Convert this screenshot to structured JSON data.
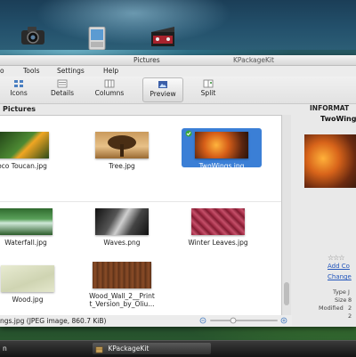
{
  "window": {
    "title": "Pictures",
    "app": "KPackageKit"
  },
  "menu": [
    "o",
    "Tools",
    "Settings",
    "Help"
  ],
  "toolbar": [
    {
      "label": "Icons",
      "icon": "icons-view-icon"
    },
    {
      "label": "Details",
      "icon": "details-view-icon"
    },
    {
      "label": "Columns",
      "icon": "columns-view-icon"
    },
    {
      "label": "Preview",
      "icon": "preview-icon",
      "active": true
    },
    {
      "label": "Split",
      "icon": "split-icon"
    }
  ],
  "location": "Pictures",
  "files": [
    {
      "name": "oco Toucan.jpg",
      "color": "#3b6d2c"
    },
    {
      "name": "Tree.jpg",
      "color": "#b07a3a"
    },
    {
      "name": "TwoWings.jpg",
      "color": "#e06a1a",
      "selected": true
    },
    {
      "name": "Waterfall.jpg",
      "color": "#3f7d45"
    },
    {
      "name": "Waves.png",
      "color": "#444444"
    },
    {
      "name": "Winter Leaves.jpg",
      "color": "#a8324a"
    },
    {
      "name": "Wood.jpg",
      "color": "#d9dcc0"
    },
    {
      "name": "Wood_Wall_2__Print_Version_by_Oliu...",
      "name_line1": "Wood_Wall_2__Print",
      "name_line2": "t_Version_by_Oliu...",
      "color": "#7a4524"
    }
  ],
  "status": "ngs.jpg (JPEG image, 860.7 KiB)",
  "info_panel": {
    "heading": "INFORMAT",
    "filename": "TwoWing",
    "links": [
      "Add Co",
      "Change"
    ],
    "fields": [
      {
        "key": "Type",
        "value": "J"
      },
      {
        "key": "Size",
        "value": "8"
      },
      {
        "key": "Modified",
        "value": "2"
      },
      {
        "key": "",
        "value": "2"
      }
    ]
  },
  "taskbar": {
    "left_task": "n",
    "active_task": "KPackageKit"
  }
}
